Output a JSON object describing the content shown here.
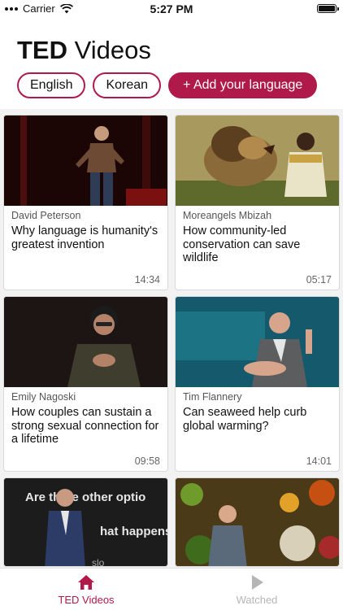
{
  "status_bar": {
    "carrier": "Carrier",
    "time": "5:27 PM"
  },
  "header": {
    "title_bold": "TED",
    "title_rest": "Videos",
    "chips": [
      "English",
      "Korean"
    ],
    "add_language": "+ Add your language"
  },
  "videos": [
    {
      "speaker": "David Peterson",
      "title": "Why language is humanity's greatest invention",
      "duration": "14:34"
    },
    {
      "speaker": "Moreangels Mbizah",
      "title": "How community-led conservation can save wildlife",
      "duration": "05:17"
    },
    {
      "speaker": "Emily Nagoski",
      "title": "How couples can sustain a strong sexual connection for a lifetime",
      "duration": "09:58"
    },
    {
      "speaker": "Tim Flannery",
      "title": "Can seaweed help curb global warming?",
      "duration": "14:01"
    }
  ],
  "thumbnail_text": {
    "line1": "Are there other optio",
    "line2": "hat happens",
    "line3": "slo"
  },
  "tabs": {
    "active": "TED Videos",
    "inactive": "Watched"
  },
  "colors": {
    "accent": "#b01a4a",
    "inactive": "#b5b5b5"
  },
  "icons": {
    "tab_active": "home-icon",
    "tab_inactive": "play-icon"
  }
}
